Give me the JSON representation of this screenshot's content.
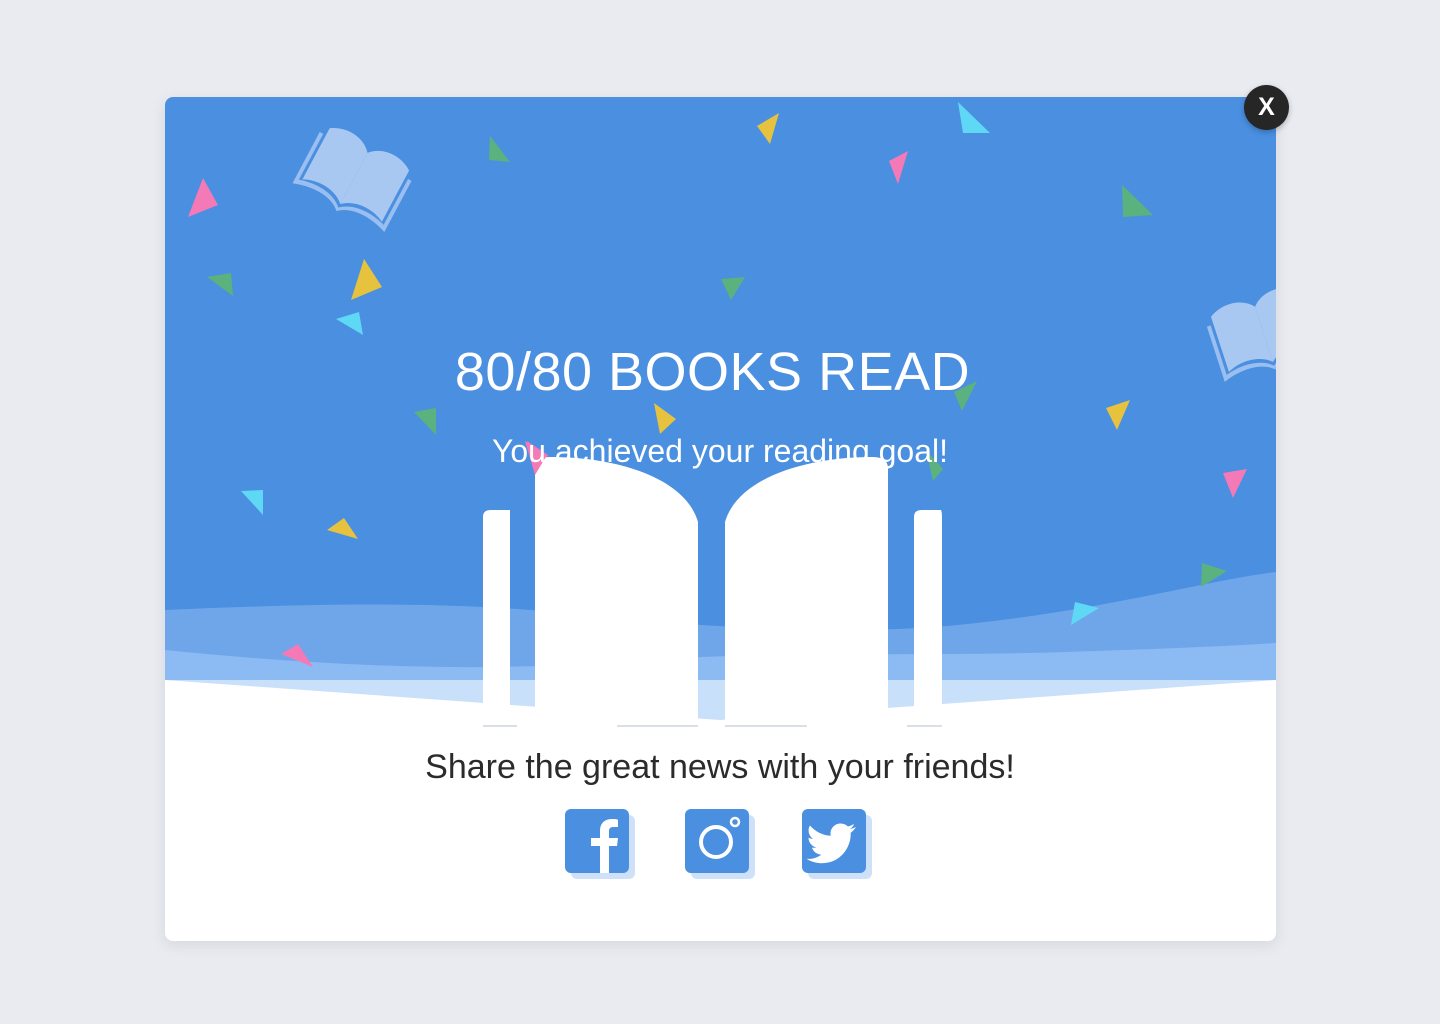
{
  "modal": {
    "title": "80/80 BOOKS READ",
    "subtitle": "You achieved your reading goal!",
    "share_text": "Share the great news with your friends!",
    "close_label": "X"
  },
  "social_buttons": [
    {
      "icon": "facebook-icon"
    },
    {
      "icon": "instagram-icon"
    },
    {
      "icon": "twitter-icon"
    }
  ],
  "colors": {
    "page_background": "#e9ebf0",
    "hero_blue": "#4a8fe0",
    "wave_light": "#6fa6ea",
    "wave_lighter": "#8cbaf2",
    "wave_lightest": "#c9e0fb",
    "confetti_pink": "#f37ab6",
    "confetti_yellow": "#e6c23e",
    "confetti_green": "#5bb27e",
    "confetti_cyan": "#5fd8f6",
    "close_button": "#262626"
  }
}
